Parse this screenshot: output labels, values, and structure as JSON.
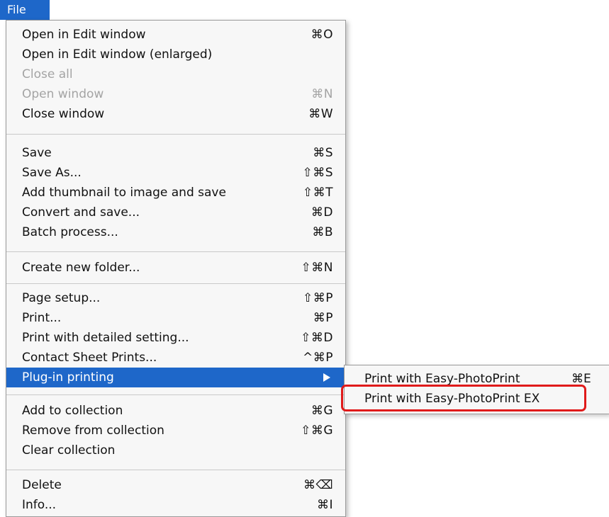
{
  "menubar": {
    "title": "File"
  },
  "menu": {
    "items": [
      {
        "label": "Open in Edit window",
        "shortcut": "⌘O"
      },
      {
        "label": "Open in Edit window (enlarged)",
        "shortcut": ""
      },
      {
        "label": "Close all",
        "shortcut": "",
        "disabled": true
      },
      {
        "label": "Open window",
        "shortcut": "⌘N",
        "disabled": true
      },
      {
        "label": "Close window",
        "shortcut": "⌘W"
      },
      {
        "label": "Save",
        "shortcut": "⌘S"
      },
      {
        "label": "Save As...",
        "shortcut": "⇧⌘S"
      },
      {
        "label": "Add thumbnail to image and save",
        "shortcut": "⇧⌘T"
      },
      {
        "label": "Convert and save...",
        "shortcut": "⌘D"
      },
      {
        "label": "Batch process...",
        "shortcut": "⌘B"
      },
      {
        "label": "Create new folder...",
        "shortcut": "⇧⌘N"
      },
      {
        "label": "Page setup...",
        "shortcut": "⇧⌘P"
      },
      {
        "label": "Print...",
        "shortcut": "⌘P"
      },
      {
        "label": "Print with detailed setting...",
        "shortcut": "⇧⌘D"
      },
      {
        "label": "Contact Sheet Prints...",
        "shortcut": "^⌘P"
      },
      {
        "label": "Plug-in printing",
        "shortcut": "",
        "highlighted": true,
        "has_submenu": true
      },
      {
        "label": "Add to collection",
        "shortcut": "⌘G"
      },
      {
        "label": "Remove from collection",
        "shortcut": "⇧⌘G"
      },
      {
        "label": "Clear collection",
        "shortcut": ""
      },
      {
        "label": "Delete",
        "shortcut": "⌘⌫"
      },
      {
        "label": "Info...",
        "shortcut": "⌘I"
      }
    ]
  },
  "submenu": {
    "items": [
      {
        "label": "Print with Easy-PhotoPrint",
        "shortcut": "⌘E"
      },
      {
        "label": "Print with Easy-PhotoPrint EX",
        "shortcut": ""
      }
    ]
  },
  "colors": {
    "highlight": "#1e67c9",
    "callout": "#e01a1a"
  }
}
